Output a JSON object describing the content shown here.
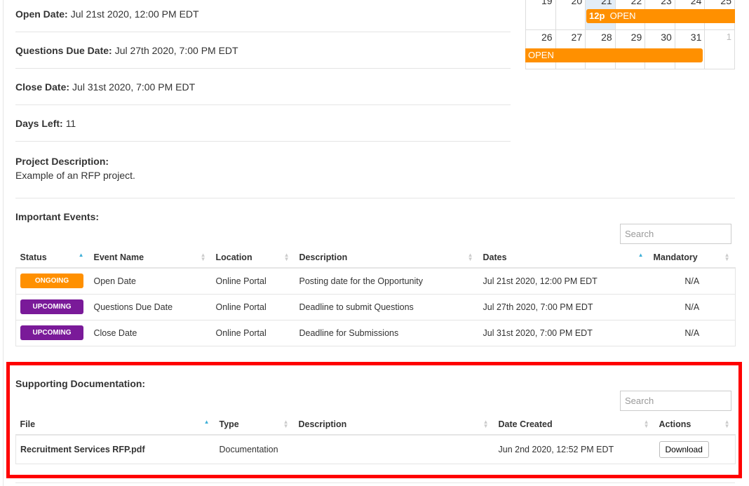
{
  "info": {
    "open_label": "Open Date:",
    "open_value": "Jul 21st 2020, 12:00 PM EDT",
    "questions_label": "Questions Due Date:",
    "questions_value": "Jul 27th 2020, 7:00 PM EDT",
    "close_label": "Close Date:",
    "close_value": "Jul 31st 2020, 7:00 PM EDT",
    "days_label": "Days Left:",
    "days_value": "11",
    "desc_label": "Project Description:",
    "desc_value": "Example of an RFP project."
  },
  "calendar": {
    "week1": [
      "19",
      "20",
      "21",
      "22",
      "23",
      "24",
      "25"
    ],
    "week2": [
      "26",
      "27",
      "28",
      "29",
      "30",
      "31",
      "1"
    ],
    "event1_time": "12p",
    "event1_title": "OPEN",
    "event2_title": "OPEN",
    "event_color": "#ff9000"
  },
  "events": {
    "title": "Important Events:",
    "search_placeholder": "Search",
    "headers": [
      "Status",
      "Event Name",
      "Location",
      "Description",
      "Dates",
      "Mandatory"
    ],
    "rows": [
      {
        "status": "ONGOING",
        "color": "#ff9000",
        "name": "Open Date",
        "location": "Online Portal",
        "description": "Posting date for the Opportunity",
        "dates": "Jul 21st 2020, 12:00 PM EDT",
        "mandatory": "N/A"
      },
      {
        "status": "UPCOMING",
        "color": "#7a1a99",
        "name": "Questions Due Date",
        "location": "Online Portal",
        "description": "Deadline to submit Questions",
        "dates": "Jul 27th 2020, 7:00 PM EDT",
        "mandatory": "N/A"
      },
      {
        "status": "UPCOMING",
        "color": "#7a1a99",
        "name": "Close Date",
        "location": "Online Portal",
        "description": "Deadline for Submissions",
        "dates": "Jul 31st 2020, 7:00 PM EDT",
        "mandatory": "N/A"
      }
    ]
  },
  "docs": {
    "title": "Supporting Documentation:",
    "search_placeholder": "Search",
    "headers": [
      "File",
      "Type",
      "Description",
      "Date Created",
      "Actions"
    ],
    "rows": [
      {
        "file": "Recruitment Services RFP.pdf",
        "type": "Documentation",
        "description": "",
        "date": "Jun 2nd 2020, 12:52 PM EDT",
        "action": "Download"
      }
    ]
  }
}
